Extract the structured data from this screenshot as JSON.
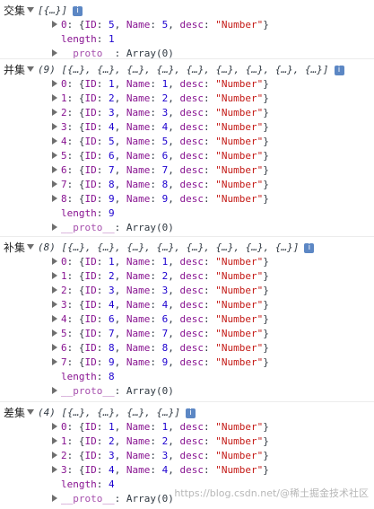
{
  "groups": [
    {
      "label": "交集",
      "summary": "[{…}]",
      "info_icon": "i",
      "items": [
        {
          "index": "0",
          "id": "5",
          "name": "5",
          "desc": "\"Number\""
        }
      ],
      "length_label": "length",
      "length_value": "1",
      "proto_label": "__proto__",
      "proto_value": "Array(0)"
    },
    {
      "label": "并集",
      "summary": "(9) [{…}, {…}, {…}, {…}, {…}, {…}, {…}, {…}, {…}]",
      "info_icon": "i",
      "items": [
        {
          "index": "0",
          "id": "1",
          "name": "1",
          "desc": "\"Number\""
        },
        {
          "index": "1",
          "id": "2",
          "name": "2",
          "desc": "\"Number\""
        },
        {
          "index": "2",
          "id": "3",
          "name": "3",
          "desc": "\"Number\""
        },
        {
          "index": "3",
          "id": "4",
          "name": "4",
          "desc": "\"Number\""
        },
        {
          "index": "4",
          "id": "5",
          "name": "5",
          "desc": "\"Number\""
        },
        {
          "index": "5",
          "id": "6",
          "name": "6",
          "desc": "\"Number\""
        },
        {
          "index": "6",
          "id": "7",
          "name": "7",
          "desc": "\"Number\""
        },
        {
          "index": "7",
          "id": "8",
          "name": "8",
          "desc": "\"Number\""
        },
        {
          "index": "8",
          "id": "9",
          "name": "9",
          "desc": "\"Number\""
        }
      ],
      "length_label": "length",
      "length_value": "9",
      "proto_label": "__proto__",
      "proto_value": "Array(0)"
    },
    {
      "label": "补集",
      "summary": "(8) [{…}, {…}, {…}, {…}, {…}, {…}, {…}, {…}]",
      "info_icon": "i",
      "items": [
        {
          "index": "0",
          "id": "1",
          "name": "1",
          "desc": "\"Number\""
        },
        {
          "index": "1",
          "id": "2",
          "name": "2",
          "desc": "\"Number\""
        },
        {
          "index": "2",
          "id": "3",
          "name": "3",
          "desc": "\"Number\""
        },
        {
          "index": "3",
          "id": "4",
          "name": "4",
          "desc": "\"Number\""
        },
        {
          "index": "4",
          "id": "6",
          "name": "6",
          "desc": "\"Number\""
        },
        {
          "index": "5",
          "id": "7",
          "name": "7",
          "desc": "\"Number\""
        },
        {
          "index": "6",
          "id": "8",
          "name": "8",
          "desc": "\"Number\""
        },
        {
          "index": "7",
          "id": "9",
          "name": "9",
          "desc": "\"Number\""
        }
      ],
      "length_label": "length",
      "length_value": "8",
      "proto_label": "__proto__",
      "proto_value": "Array(0)"
    },
    {
      "label": "差集",
      "summary": "(4) [{…}, {…}, {…}, {…}]",
      "info_icon": "i",
      "items": [
        {
          "index": "0",
          "id": "1",
          "name": "1",
          "desc": "\"Number\""
        },
        {
          "index": "1",
          "id": "2",
          "name": "2",
          "desc": "\"Number\""
        },
        {
          "index": "2",
          "id": "3",
          "name": "3",
          "desc": "\"Number\""
        },
        {
          "index": "3",
          "id": "4",
          "name": "4",
          "desc": "\"Number\""
        }
      ],
      "length_label": "length",
      "length_value": "4",
      "proto_label": "__proto__",
      "proto_value": "Array(0)"
    }
  ],
  "watermark": "https://blog.csdn.net/@稀土掘金技术社区"
}
